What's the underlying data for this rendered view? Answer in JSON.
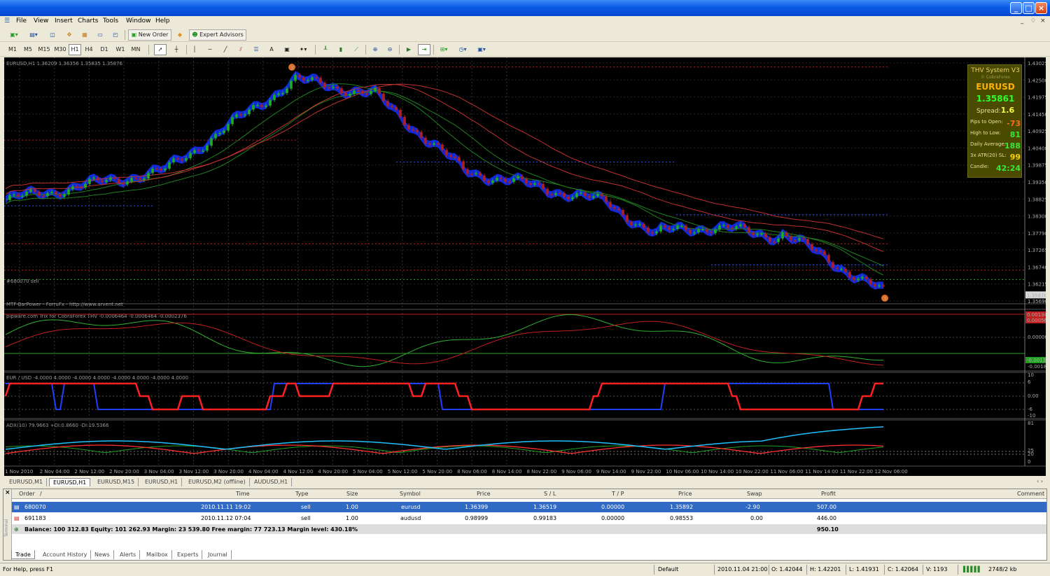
{
  "window": {
    "controls": [
      "_",
      "□",
      "×"
    ]
  },
  "menu": {
    "items": [
      "File",
      "View",
      "Insert",
      "Charts",
      "Tools",
      "Window",
      "Help"
    ],
    "mdi": [
      "_",
      "♢",
      "×"
    ]
  },
  "toolbar": {
    "new_order": "New Order",
    "expert_advisors": "Expert Advisors"
  },
  "timeframes": {
    "items": [
      "M1",
      "M5",
      "M15",
      "M30",
      "H1",
      "H4",
      "D1",
      "W1",
      "MN"
    ],
    "active": "H1"
  },
  "draw_tools": {
    "text": "A"
  },
  "chart": {
    "price_label": "EURUSD,H1  1.36209 1.36356 1.35835 1.35876",
    "order_label": "#680070 sell",
    "mtf_label": "MTF-BarPower - ForruFx - http://www.arvent.net",
    "price_axis": [
      "1.43025",
      "1.42500",
      "1.41975",
      "1.41450",
      "1.40925",
      "1.40400",
      "1.39875",
      "1.39350",
      "1.38825",
      "1.38300",
      "1.37790",
      "1.37265",
      "1.36740",
      "1.36215",
      "1.35690"
    ],
    "current_price": "1.35876",
    "arrow_marker": "3",
    "trix_label": "pipware.com Trix for CobraForex THV -0.0006464 -0.0006464 -0.0002376",
    "trix_axis": [
      "0.00000",
      "-0.00187"
    ],
    "trix_tags": [
      "0.00134",
      "0.00056",
      "-0.00134"
    ],
    "eur_label": "EUR / USD -4.0000 4.0000 -4.0000 4.0000 -4.0000 4.0000 -4.0000 4.0000",
    "eur_axis": [
      "10",
      "6",
      "0.00",
      "-6",
      "-10"
    ],
    "adx_label": "ADX(10) 79.9663 +DI:0.8660 -DI:19.5366",
    "adx_axis": [
      "81",
      "25",
      "20",
      "0"
    ],
    "time_axis": [
      "1 Nov 2010",
      "2 Nov 04:00",
      "2 Nov 12:00",
      "2 Nov 20:00",
      "3 Nov 04:00",
      "3 Nov 12:00",
      "3 Nov 20:00",
      "4 Nov 04:00",
      "4 Nov 12:00",
      "4 Nov 20:00",
      "5 Nov 04:00",
      "5 Nov 12:00",
      "5 Nov 20:00",
      "8 Nov 06:00",
      "8 Nov 14:00",
      "8 Nov 22:00",
      "9 Nov 06:00",
      "9 Nov 14:00",
      "9 Nov 22:00",
      "10 Nov 06:00",
      "10 Nov 14:00",
      "10 Nov 22:00",
      "11 Nov 06:00",
      "11 Nov 14:00",
      "11 Nov 22:00",
      "12 Nov 06:00"
    ],
    "colors": {
      "bull": "#1fae1f",
      "bear": "#b01f1f",
      "cloud": "#1030ff",
      "ma_red": "#c03030",
      "ma_green": "#208020"
    }
  },
  "thv": {
    "title": "THV System V3",
    "subtitle": "© CobraForex",
    "symbol": "EURUSD",
    "price": "1.35861",
    "spread_label": "Spread:",
    "spread": "1.6",
    "rows": [
      {
        "label": "Pips to Open:",
        "value": "-73",
        "color": "#ff6a1a"
      },
      {
        "label": "High to Low:",
        "value": "81",
        "color": "#39e639"
      },
      {
        "label": "Daily Average:",
        "value": "188",
        "color": "#39e639"
      },
      {
        "label": "3x ATR(20) SL:",
        "value": "99",
        "color": "#ffd000"
      },
      {
        "label": "Candle:",
        "value": "42:24",
        "color": "#39e639"
      }
    ]
  },
  "chart_tabs": {
    "items": [
      "EURUSD,M1",
      "EURUSD,H1",
      "EURUSD,M15",
      "EURUSD,H1",
      "EURUSD,M2 (offline)",
      "AUDUSD,H1"
    ],
    "active": 1,
    "scroll": "‹ ›"
  },
  "trade": {
    "headers": [
      "Order",
      "/",
      "Time",
      "Type",
      "Size",
      "Symbol",
      "Price",
      "S / L",
      "T / P",
      "Price",
      "Swap",
      "Profit",
      "Comment"
    ],
    "rows": [
      {
        "order": "680070",
        "time": "2010.11.11 19:02",
        "type": "sell",
        "size": "1.00",
        "symbol": "eurusd",
        "price": "1.36399",
        "sl": "1.36519",
        "tp": "0.00000",
        "cur_price": "1.35892",
        "swap": "-2.90",
        "profit": "507.00"
      },
      {
        "order": "691183",
        "time": "2010.11.12 07:04",
        "type": "sell",
        "size": "1.00",
        "symbol": "audusd",
        "price": "0.98999",
        "sl": "0.99183",
        "tp": "0.00000",
        "cur_price": "0.98553",
        "swap": "0.00",
        "profit": "446.00"
      }
    ],
    "balance_line": "Balance: 100 312.83  Equity: 101 262.93  Margin: 23 539.80  Free margin: 77 723.13  Margin level: 430.18%",
    "balance_profit": "950.10",
    "side_label": "Terminal",
    "close": "×"
  },
  "terminal_tabs": {
    "items": [
      "Trade",
      "Account History",
      "News",
      "Alerts",
      "Mailbox",
      "Experts",
      "Journal"
    ],
    "active": 0
  },
  "status": {
    "help": "For Help, press F1",
    "profile": "Default",
    "datetime": "2010.11.04 21:00",
    "open": "O: 1.42044",
    "high": "H: 1.42201",
    "low": "L: 1.41931",
    "close": "C: 1.42064",
    "volume": "V: 1193",
    "traffic": "2748/2 kb"
  }
}
